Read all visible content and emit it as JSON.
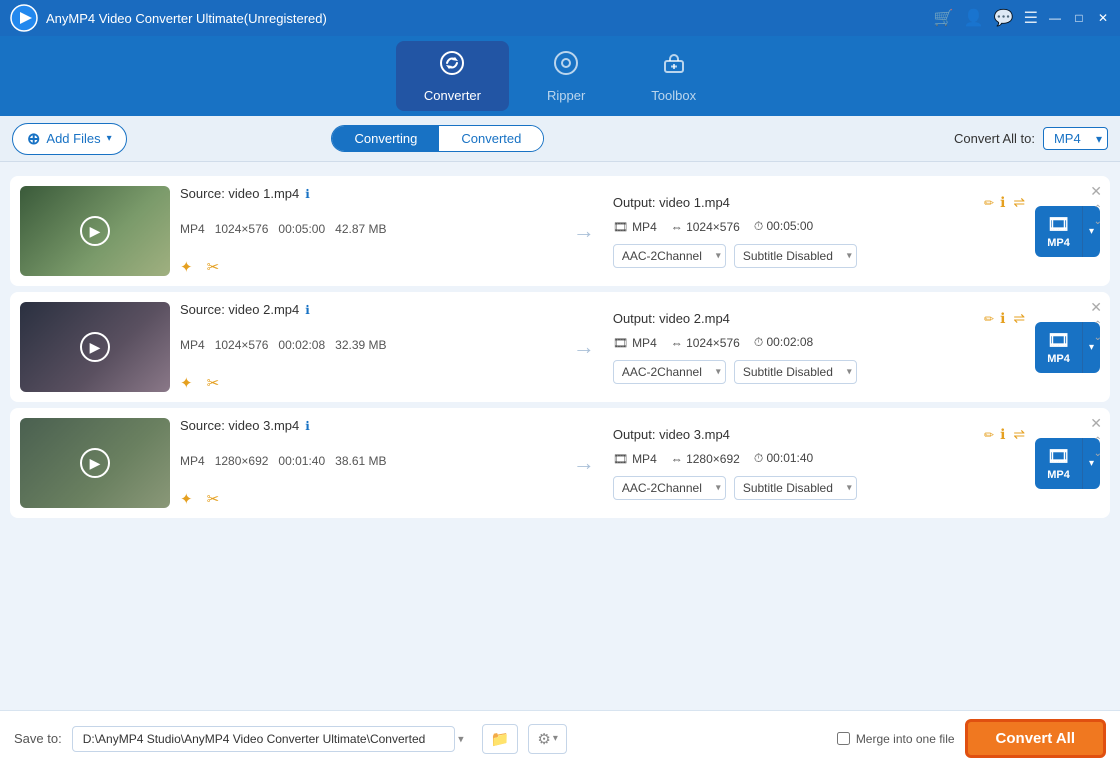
{
  "app": {
    "title": "AnyMP4 Video Converter Ultimate(Unregistered)",
    "logo_text": "▶"
  },
  "titlebar": {
    "cart_icon": "🛒",
    "user_icon": "👤",
    "chat_icon": "💬",
    "menu_icon": "☰",
    "minimize_icon": "—",
    "maximize_icon": "□",
    "close_icon": "✕"
  },
  "nav": {
    "items": [
      {
        "id": "converter",
        "label": "Converter",
        "icon": "↻",
        "active": true
      },
      {
        "id": "ripper",
        "label": "Ripper",
        "icon": "⊙"
      },
      {
        "id": "toolbox",
        "label": "Toolbox",
        "icon": "⊡"
      }
    ]
  },
  "toolbar": {
    "add_files_label": "Add Files",
    "tabs": [
      "Converting",
      "Converted"
    ],
    "active_tab": "Converting",
    "convert_all_to_label": "Convert All to:",
    "convert_format": "MP4"
  },
  "files": [
    {
      "id": 1,
      "source_label": "Source: video 1.mp4",
      "output_label": "Output: video 1.mp4",
      "format": "MP4",
      "resolution_in": "1024×576",
      "duration_in": "00:05:00",
      "size": "42.87 MB",
      "format_out": "MP4",
      "resolution_out": "1024×576",
      "duration_out": "00:05:00",
      "audio": "AAC-2Channel",
      "subtitle": "Subtitle Disabled",
      "thumb_class": "thumb-bg1"
    },
    {
      "id": 2,
      "source_label": "Source: video 2.mp4",
      "output_label": "Output: video 2.mp4",
      "format": "MP4",
      "resolution_in": "1024×576",
      "duration_in": "00:02:08",
      "size": "32.39 MB",
      "format_out": "MP4",
      "resolution_out": "1024×576",
      "duration_out": "00:02:08",
      "audio": "AAC-2Channel",
      "subtitle": "Subtitle Disabled",
      "thumb_class": "thumb-bg2"
    },
    {
      "id": 3,
      "source_label": "Source: video 3.mp4",
      "output_label": "Output: video 3.mp4",
      "format": "MP4",
      "resolution_in": "1280×692",
      "duration_in": "00:01:40",
      "size": "38.61 MB",
      "format_out": "MP4",
      "resolution_out": "1280×692",
      "duration_out": "00:01:40",
      "audio": "AAC-2Channel",
      "subtitle": "Subtitle Disabled",
      "thumb_class": "thumb-bg3"
    }
  ],
  "bottom": {
    "save_to_label": "Save to:",
    "save_path": "D:\\AnyMP4 Studio\\AnyMP4 Video Converter Ultimate\\Converted",
    "merge_label": "Merge into one file",
    "convert_all_label": "Convert All"
  },
  "icons": {
    "plus": "⊕",
    "arrow_down": "▾",
    "arrow_right": "→",
    "play": "▶",
    "star": "✦",
    "scissors": "✂",
    "info": "ℹ",
    "edit": "✏",
    "settings": "⚙",
    "sliders": "⇌",
    "folder": "📁",
    "close": "✕",
    "chevron_up": "⌃",
    "chevron_down": "⌄",
    "film": "🎞"
  }
}
